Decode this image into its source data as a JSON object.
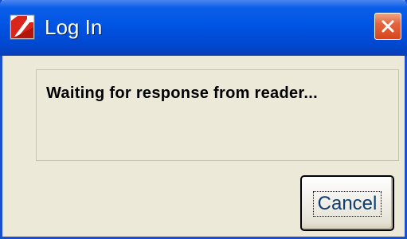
{
  "window": {
    "title": "Log In",
    "close_label": "×"
  },
  "message": {
    "text": "Waiting for response from reader..."
  },
  "buttons": {
    "cancel_label": "Cancel"
  },
  "icons": {
    "title_icon": "app-logo-icon",
    "close_icon": "close-icon"
  },
  "colors": {
    "titlebar": "#0054e3",
    "close_button": "#e3653f",
    "window_face": "#ece9d8",
    "cancel_text": "#0b3d6e"
  }
}
